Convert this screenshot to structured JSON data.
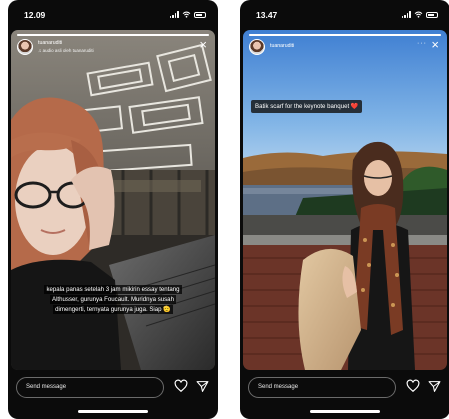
{
  "screens": [
    {
      "status_time": "12.09",
      "username": "tuanaruditi",
      "audio_line": "♫ audio asli oleh tuanaruditi",
      "caption_lines": [
        "kepala panas setelah 3 jam mikirin essay tentang",
        "Althusser, gurunya Foucault. Muridnya susah",
        "dimengerti, ternyata gurunya juga. Siap 🫡"
      ],
      "reply_placeholder": "Send message",
      "progress": 1.0,
      "icons": [
        "signal-icon",
        "wifi-icon",
        "battery-icon",
        "close-icon",
        "heart-icon",
        "send-icon"
      ]
    },
    {
      "status_time": "13.47",
      "username": "tuanaruditi",
      "caption_lines": [
        "Batik scarf for the keynote banquet ❤️"
      ],
      "reply_placeholder": "Send message",
      "progress": 1.0,
      "icons": [
        "signal-icon",
        "wifi-icon",
        "battery-icon",
        "more-icon",
        "close-icon",
        "heart-icon",
        "send-icon"
      ]
    }
  ]
}
